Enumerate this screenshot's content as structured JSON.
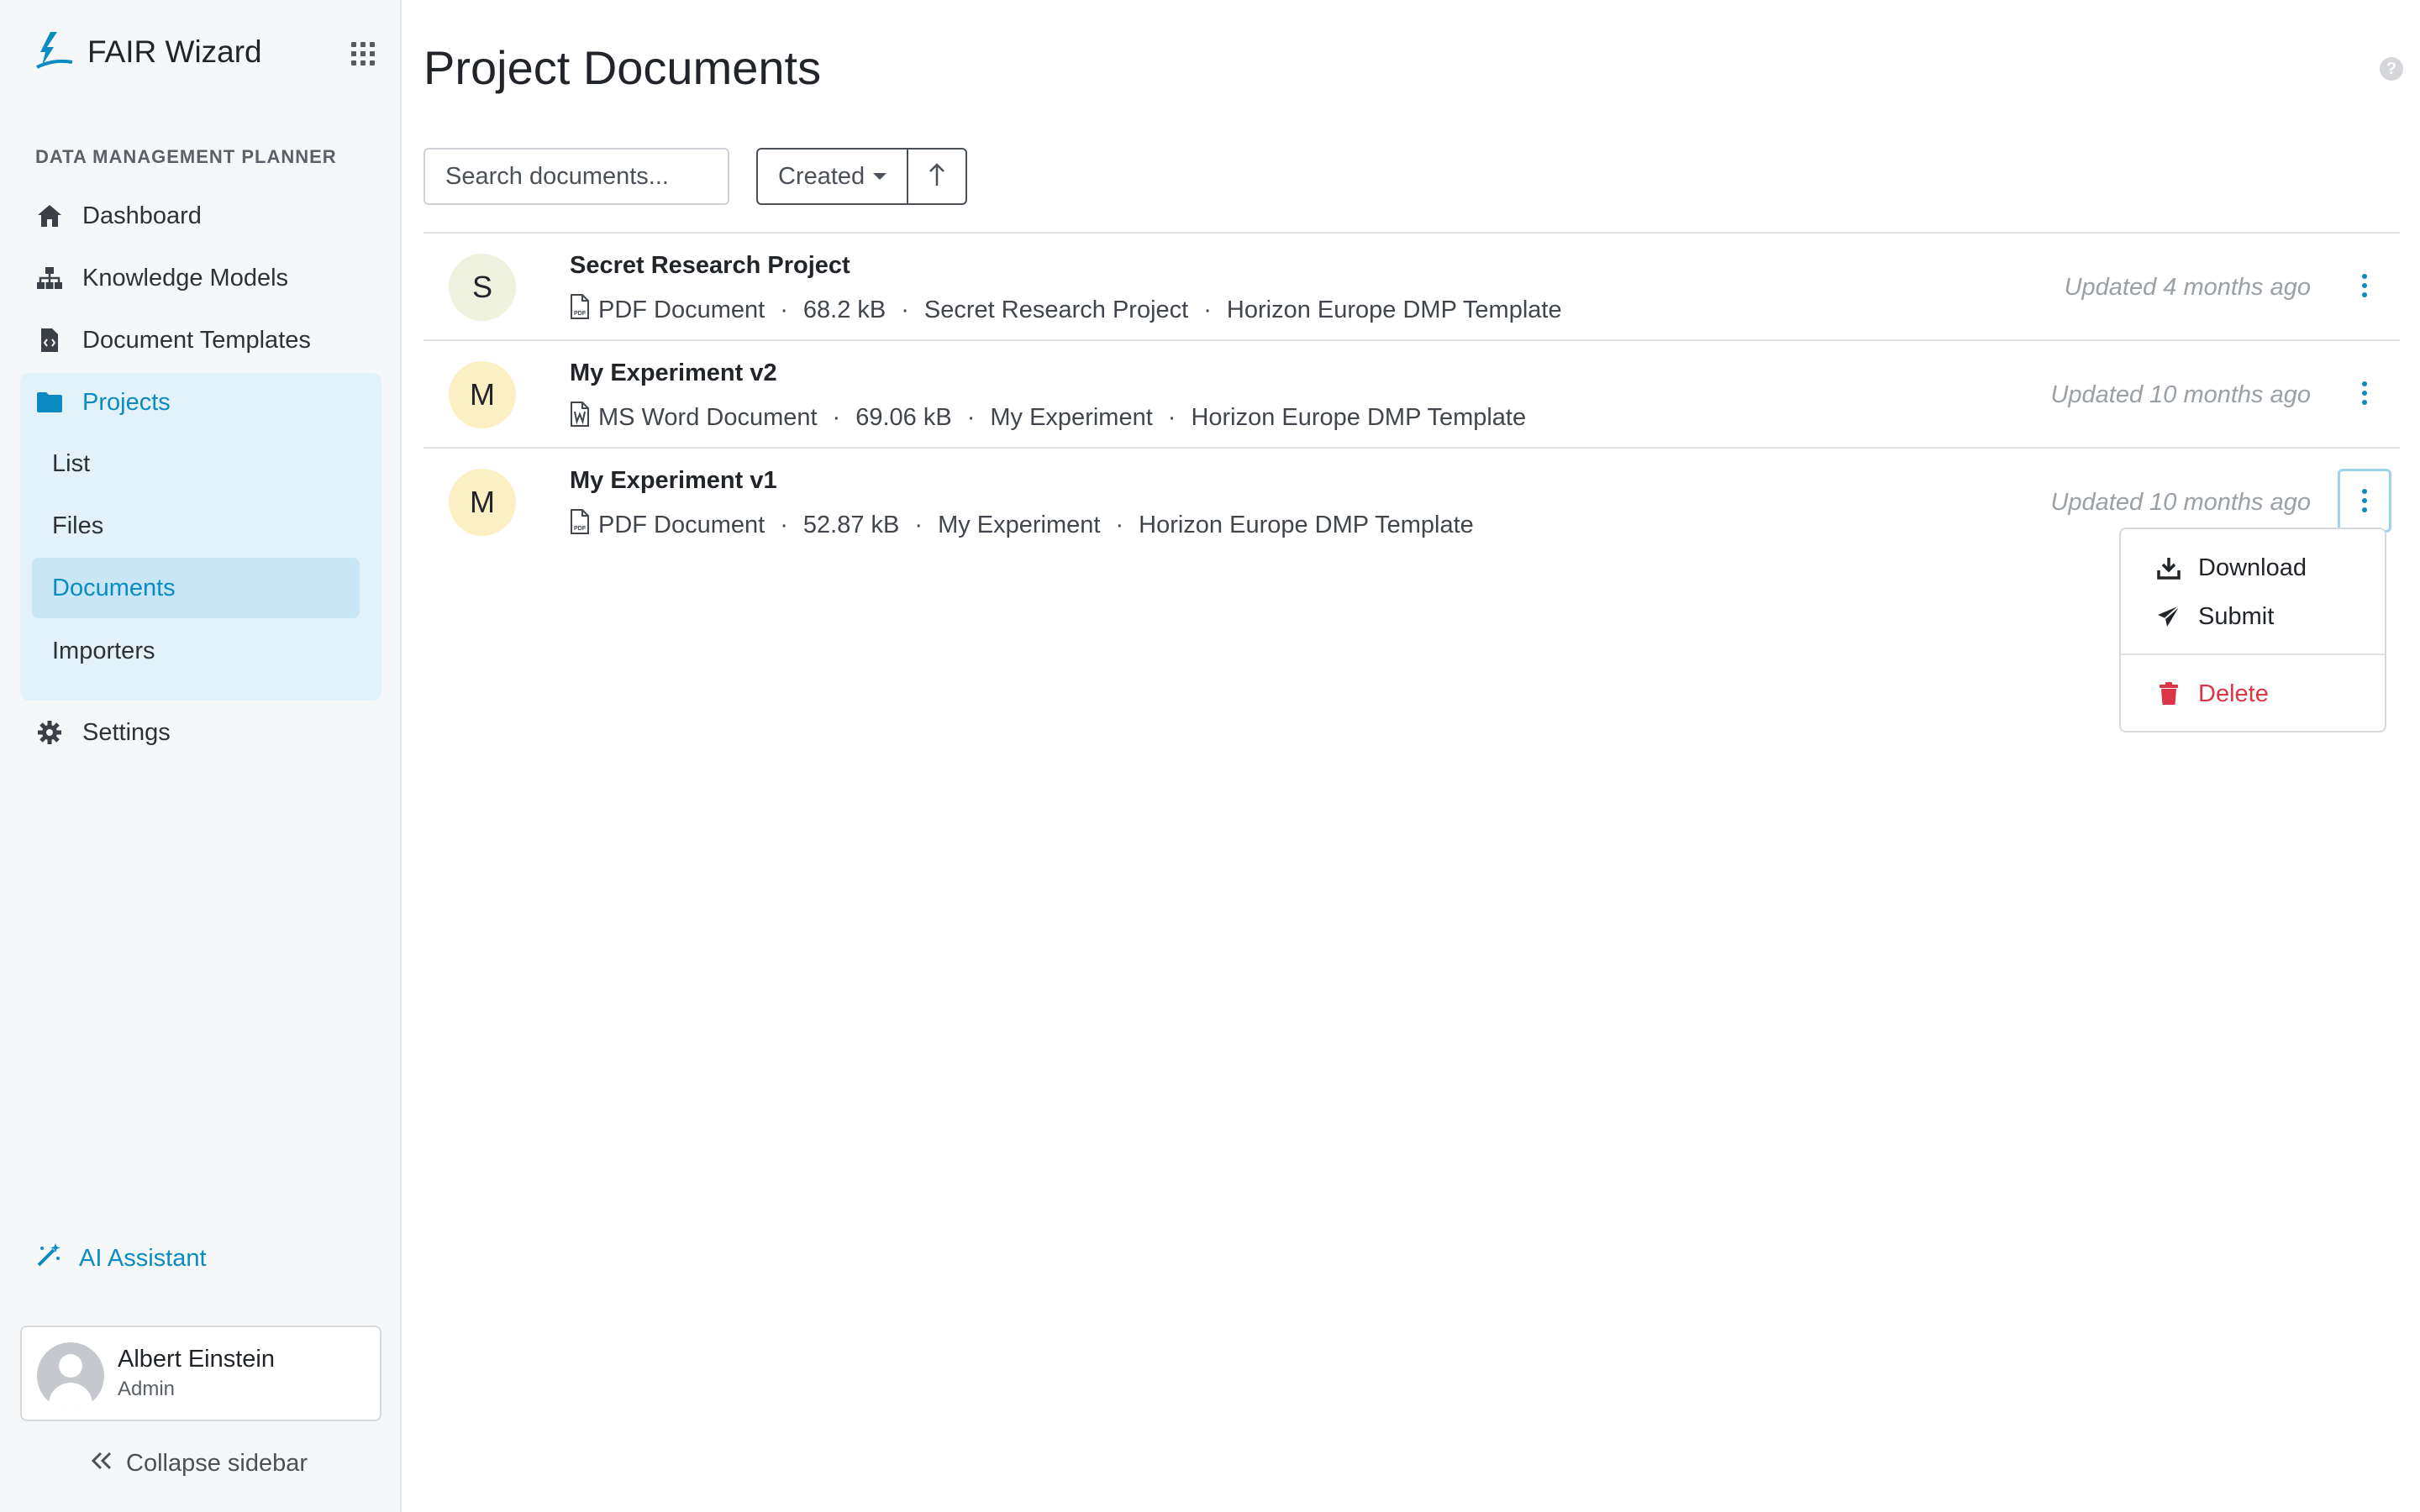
{
  "app": {
    "name": "FAIR Wizard"
  },
  "sidebar": {
    "section_label": "DATA MANAGEMENT PLANNER",
    "items": [
      {
        "label": "Dashboard",
        "icon": "home-icon"
      },
      {
        "label": "Knowledge Models",
        "icon": "sitemap-icon"
      },
      {
        "label": "Document Templates",
        "icon": "file-code-icon"
      },
      {
        "label": "Projects",
        "icon": "folder-icon"
      }
    ],
    "project_subitems": [
      {
        "label": "List"
      },
      {
        "label": "Files"
      },
      {
        "label": "Documents"
      },
      {
        "label": "Importers"
      }
    ],
    "settings_label": "Settings",
    "ai_label": "AI Assistant",
    "user": {
      "name": "Albert Einstein",
      "role": "Admin"
    },
    "collapse_label": "Collapse sidebar"
  },
  "main": {
    "title": "Project Documents",
    "search_placeholder": "Search documents...",
    "sort_label": "Created",
    "documents": [
      {
        "initial": "S",
        "avatar_color": "#eef2df",
        "title": "Secret Research Project",
        "format": "PDF Document",
        "format_icon": "pdf-file-icon",
        "size": "68.2 kB",
        "project": "Secret Research Project",
        "template": "Horizon Europe DMP Template",
        "updated": "Updated 4 months ago"
      },
      {
        "initial": "M",
        "avatar_color": "#fbf0c4",
        "title": "My Experiment v2",
        "format": "MS Word Document",
        "format_icon": "word-file-icon",
        "size": "69.06 kB",
        "project": "My Experiment",
        "template": "Horizon Europe DMP Template",
        "updated": "Updated 10 months ago"
      },
      {
        "initial": "M",
        "avatar_color": "#fbf0c4",
        "title": "My Experiment v1",
        "format": "PDF Document",
        "format_icon": "pdf-file-icon",
        "size": "52.87 kB",
        "project": "My Experiment",
        "template": "Horizon Europe DMP Template",
        "updated": "Updated 10 months ago"
      }
    ],
    "dropdown": {
      "download": "Download",
      "submit": "Submit",
      "delete": "Delete"
    }
  },
  "colors": {
    "accent": "#0a8cc2",
    "danger": "#dc3545",
    "sidebar_bg": "#f6f7f8",
    "active_bg": "#c8e6f5"
  }
}
